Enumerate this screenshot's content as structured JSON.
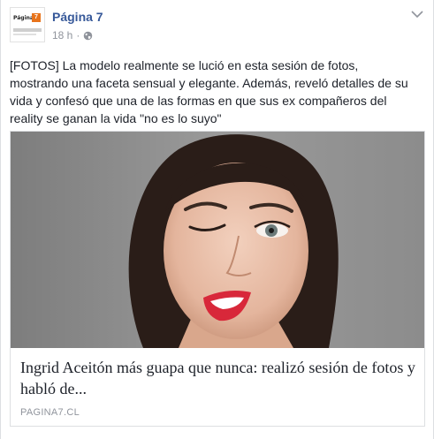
{
  "post": {
    "page_name": "Página 7",
    "timestamp": "18 h",
    "separator": "·",
    "audience_icon": "globe-icon",
    "text": "[FOTOS] La modelo realmente se lució en esta sesión de fotos,\nmostrando una faceta sensual y elegante. Además, reveló detalles de su\nvida y confesó que una de las formas en que sus ex compañeros del\nreality se ganan la vida \"no es lo suyo\""
  },
  "avatar": {
    "logo_text": "Página",
    "logo_number": "7",
    "accent": "#e8741c"
  },
  "link": {
    "title": "Ingrid Aceitón más guapa que nunca: realizó sesión de fotos y habló de...",
    "domain": "PAGINA7.CL",
    "image_subject": "woman-winking-photo"
  },
  "colors": {
    "link_blue": "#365899",
    "meta_gray": "#90949c",
    "text": "#1d2129",
    "border": "#dddfe2",
    "lips": "#d8283a"
  }
}
